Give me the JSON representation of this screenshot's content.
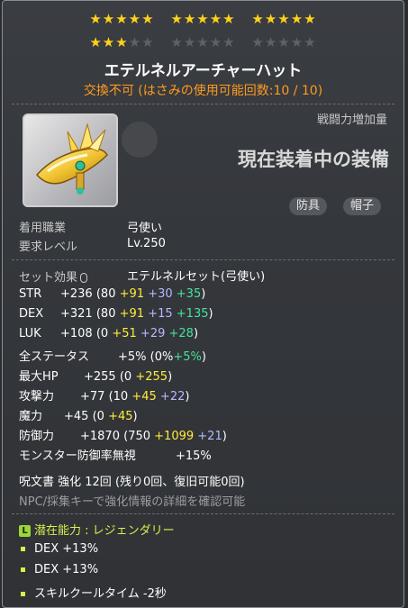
{
  "stars": {
    "row1": [
      "★★★★★",
      "★★★★★",
      "★★★★★"
    ],
    "row2_on": "★★★",
    "row2_off_a": "★★",
    "row2_off_b": "★★★★★",
    "row2_off_c": "★★★★★"
  },
  "item": {
    "name": "エテルネルアーチャーハット",
    "trade_status": "交換不可 (はさみの使用可能回数:10 / 10)",
    "power_label": "戦闘力増加量",
    "equipped_label": "現在装着中の装備",
    "tags": [
      "防具",
      "帽子"
    ]
  },
  "requirements": {
    "job_label": "着用職業",
    "job_value": "弓使い",
    "level_label": "要求レベル",
    "level_value": "Lv.250"
  },
  "set": {
    "label": "セット効果",
    "name": "エテルネルセット(弓使い)"
  },
  "stats": [
    {
      "name": "STR",
      "total": "+236",
      "open": "(80",
      "p1": "+91",
      "p2": "+30",
      "p3": "+35",
      "close": ")"
    },
    {
      "name": "DEX",
      "total": "+321",
      "open": "(80",
      "p1": "+91",
      "p2": "+15",
      "p3": "+135",
      "close": ")"
    },
    {
      "name": "LUK",
      "total": "+108",
      "open": "(0",
      "p1": "+51",
      "p2": "+29",
      "p3": "+28",
      "close": ")"
    }
  ],
  "stats2": {
    "allstat_name": "全ステータス",
    "allstat_total": "+5%",
    "allstat_open": "(0%",
    "allstat_p3": "+5%",
    "allstat_close": ")",
    "hp_name": "最大HP",
    "hp_total": "+255",
    "hp_open": "(0",
    "hp_p1": "+255",
    "hp_close": ")",
    "atk_name": "攻撃力",
    "atk_total": "+77",
    "atk_open": "(10",
    "atk_p1": "+45",
    "atk_p2": "+22",
    "atk_close": ")",
    "mag_name": "魔力",
    "mag_total": "+45",
    "mag_open": "(0",
    "mag_p1": "+45",
    "mag_close": ")",
    "def_name": "防御力",
    "def_total": "+1870",
    "def_open": "(750",
    "def_p1": "+1099",
    "def_p2": "+21",
    "def_close": ")",
    "ied_name": "モンスター防御率無視",
    "ied_total": "+15%"
  },
  "scroll": {
    "text": "呪文書 強化 12回 (残り0回、復旧可能0回)",
    "hint": "NPC/採集キーで強化情報の詳細を確認可能"
  },
  "potential": {
    "badge": "L",
    "header": "潜在能力 : レジェンダリー",
    "lines": [
      "DEX +13%",
      "DEX +13%",
      "スキルクールタイム -2秒"
    ]
  },
  "colors": {
    "gold": "#ffd21a",
    "orange": "#ff9b1e",
    "yellow": "#ffec3b",
    "blue": "#b6b9ff",
    "green": "#46e39b",
    "legendary": "#d6f24a"
  }
}
